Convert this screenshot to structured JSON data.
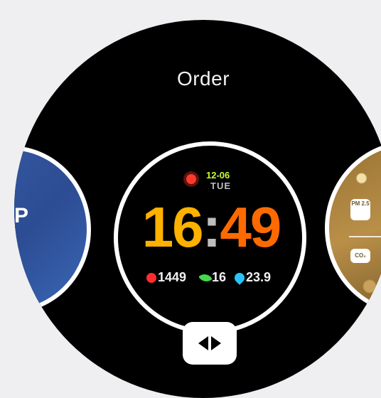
{
  "screen": {
    "title": "Order"
  },
  "left_face": {
    "hint_glyph": "P"
  },
  "center_face": {
    "date": "12-06",
    "weekday": "TUE",
    "time": {
      "hours": "16",
      "separator": ":",
      "minutes": "49"
    },
    "stats": [
      {
        "icon": "heart-icon",
        "value": "1449"
      },
      {
        "icon": "leaf-icon",
        "value": "16"
      },
      {
        "icon": "drop-icon",
        "value": "23.9"
      }
    ],
    "colors": {
      "hours": "#ffb100",
      "minutes": "#ff6a00",
      "date": "#c7ff2d"
    }
  },
  "right_face": {
    "badges": [
      "PM 2.5",
      "CO₂"
    ]
  },
  "reorder_button": {
    "icon": "left-right-arrows-icon"
  }
}
